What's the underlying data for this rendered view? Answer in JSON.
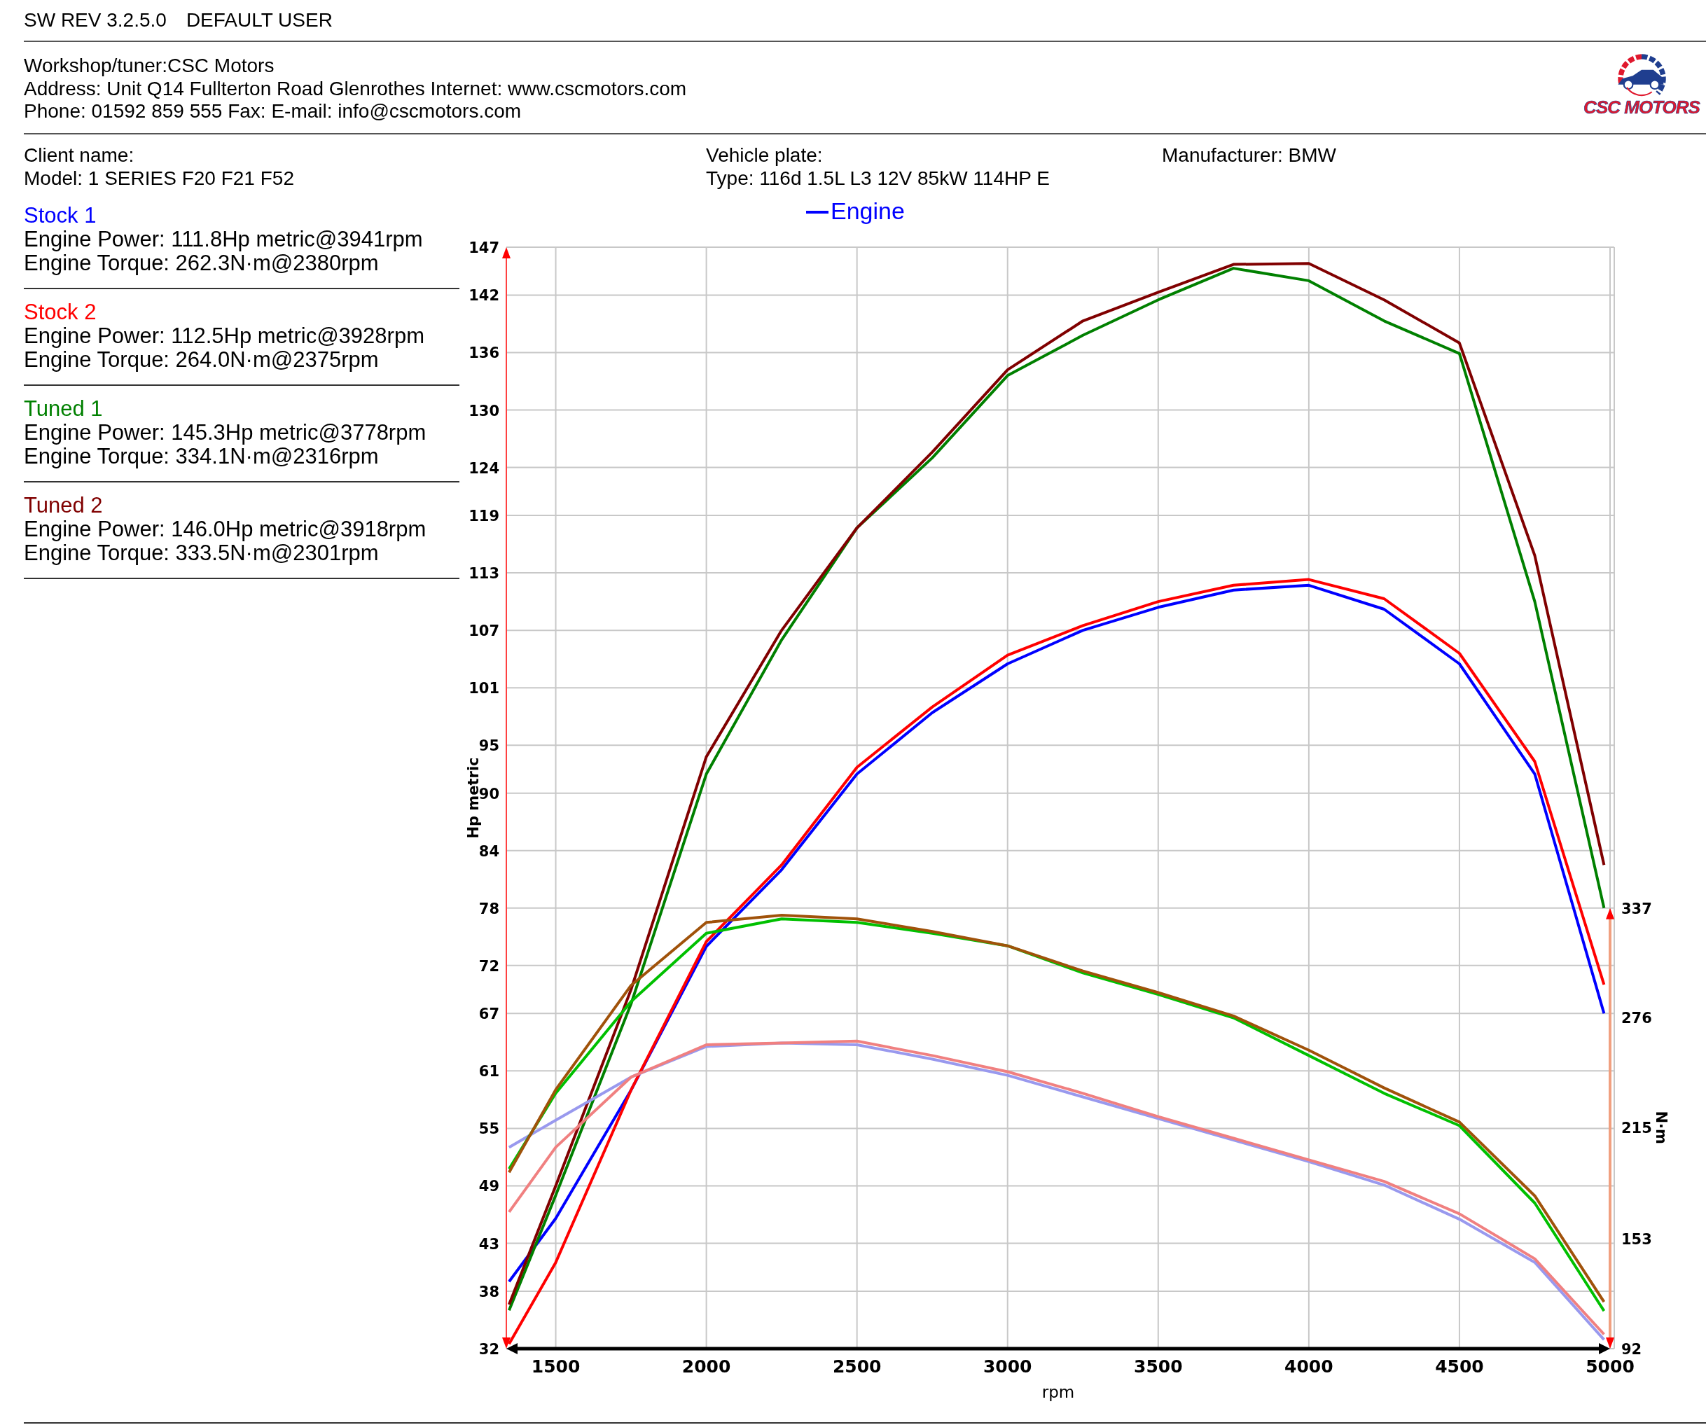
{
  "top_bar": {
    "software": "SW REV 3.2.5.0",
    "user": "DEFAULT USER"
  },
  "workshop": {
    "lines": [
      "Workshop/tuner:CSC Motors",
      "Address: Unit Q14 Fullterton Road Glenrothes Internet: www.cscmotors.com",
      "Phone: 01592 859 555 Fax:  E-mail: info@cscmotors.com"
    ],
    "logo_text": "CSC MOTORS"
  },
  "vehicle": {
    "columns": [
      [
        "Client name:",
        "Model: 1 SERIES F20 F21 F52"
      ],
      [
        "Vehicle plate:",
        "Type: 116d 1.5L L3 12V 85kW 114HP E"
      ],
      [
        "Manufacturer: BMW"
      ]
    ]
  },
  "results": [
    {
      "name": "Stock 1",
      "color": "#0000ff",
      "power": "Engine Power: 111.8Hp metric@3941rpm",
      "torque": "Engine Torque: 262.3N·m@2380rpm"
    },
    {
      "name": "Stock 2",
      "color": "#ff0000",
      "power": "Engine Power: 112.5Hp metric@3928rpm",
      "torque": "Engine Torque: 264.0N·m@2375rpm"
    },
    {
      "name": "Tuned 1",
      "color": "#008000",
      "power": "Engine Power: 145.3Hp metric@3778rpm",
      "torque": "Engine Torque: 334.1N·m@2316rpm"
    },
    {
      "name": "Tuned 2",
      "color": "#800000",
      "power": "Engine Power: 146.0Hp metric@3918rpm",
      "torque": "Engine Torque: 333.5N·m@2301rpm"
    }
  ],
  "chart": {
    "power_chart": {
      "chart_data": {
        "type": "line",
        "title": "Engine",
        "xlabel": "rpm",
        "ylabel": "Hp metric",
        "xlim": [
          1336,
          5000
        ],
        "ylim": [
          32,
          147
        ],
        "grid": true,
        "xticks": [
          1500,
          2000,
          2500,
          3000,
          3500,
          4000,
          4500,
          5000
        ],
        "yticks": [
          32,
          38,
          43,
          49,
          55,
          61,
          67,
          72,
          78,
          84,
          90,
          95,
          101,
          107,
          113,
          119,
          124,
          130,
          136,
          142,
          147
        ],
        "x": [
          1345,
          1500,
          1750,
          2000,
          2250,
          2500,
          2750,
          3000,
          3250,
          3500,
          3750,
          4000,
          4250,
          4500,
          4750,
          4980
        ],
        "series": [
          {
            "color": "#0000ff",
            "values": [
              39,
              45.6,
              59,
              74,
              82,
              92,
              98.4,
              103.5,
              107,
              109.4,
              111.2,
              111.7,
              109.2,
              103.5,
              92,
              67
            ]
          },
          {
            "color": "#ff0000",
            "values": [
              32.5,
              41,
              59,
              74.5,
              82.5,
              92.7,
              99,
              104.4,
              107.5,
              110,
              111.7,
              112.3,
              110.3,
              104.6,
              93.3,
              70
            ]
          },
          {
            "color": "#008000",
            "values": [
              36,
              48,
              68,
              92,
              106,
              117.7,
              125,
              133.6,
              137.8,
              141.5,
              144.8,
              143.5,
              139.3,
              135.9,
              110,
              78
            ]
          },
          {
            "color": "#800000",
            "values": [
              36.6,
              49,
              69.5,
              93.8,
              107,
              117.7,
              125.6,
              134.2,
              139.3,
              142.3,
              145.2,
              145.3,
              141.5,
              137,
              114.8,
              82.5
            ]
          }
        ]
      }
    },
    "torque_chart": {
      "chart_data": {
        "type": "line",
        "ylabel": "N·m",
        "xlim": [
          1336,
          5000
        ],
        "ylim": [
          92,
          337
        ],
        "yticks": [
          92,
          153,
          215,
          276,
          337
        ],
        "x": [
          1345,
          1500,
          1750,
          2000,
          2250,
          2500,
          2750,
          3000,
          3250,
          3500,
          3750,
          4000,
          4250,
          4500,
          4750,
          4980
        ],
        "series": [
          {
            "color": "#9999ee",
            "values": [
              204,
              219,
              243,
              260,
              262,
              261,
              253,
              244,
              232,
              220,
              208,
              196,
              183,
              164,
              140,
              97
            ]
          },
          {
            "color": "#f08080",
            "values": [
              168,
              204,
              243,
              261,
              262,
              263,
              255,
              246,
              234,
              221,
              209,
              197,
              185,
              167,
              142,
              100
            ]
          },
          {
            "color": "#00c000",
            "values": [
              192,
              234,
              285,
              323,
              331,
              329,
              323,
              316,
              301,
              289,
              276,
              255,
              234,
              216,
              173,
              113
            ]
          },
          {
            "color": "#a0520a",
            "values": [
              190,
              236,
              294,
              329,
              333,
              331,
              324,
              316,
              302,
              290,
              277,
              258,
              237,
              218,
              177,
              118
            ]
          }
        ]
      }
    }
  }
}
